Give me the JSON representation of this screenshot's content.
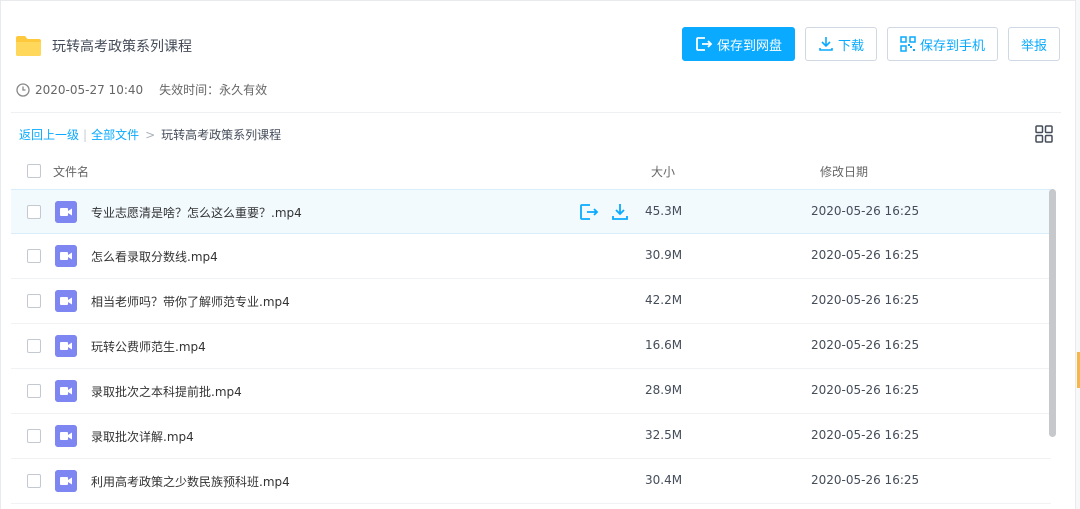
{
  "share": {
    "title": "玩转高考政策系列课程",
    "date": "2020-05-27 10:40",
    "expire_label": "失效时间：",
    "expire_value": "永久有效"
  },
  "actions": {
    "save_to_disk": "保存到网盘",
    "download": "下载",
    "save_to_phone": "保存到手机",
    "report": "举报"
  },
  "breadcrumb": {
    "back": "返回上一级",
    "sep": "|",
    "all_files": "全部文件",
    "arrow": ">",
    "current": "玩转高考政策系列课程"
  },
  "columns": {
    "name": "文件名",
    "size": "大小",
    "date": "修改日期"
  },
  "files": [
    {
      "name": "专业志愿清是啥？怎么这么重要？.mp4",
      "size": "45.3M",
      "date": "2020-05-26 16:25"
    },
    {
      "name": "怎么看录取分数线.mp4",
      "size": "30.9M",
      "date": "2020-05-26 16:25"
    },
    {
      "name": "相当老师吗？带你了解师范专业.mp4",
      "size": "42.2M",
      "date": "2020-05-26 16:25"
    },
    {
      "name": "玩转公费师范生.mp4",
      "size": "16.6M",
      "date": "2020-05-26 16:25"
    },
    {
      "name": "录取批次之本科提前批.mp4",
      "size": "28.9M",
      "date": "2020-05-26 16:25"
    },
    {
      "name": "录取批次详解.mp4",
      "size": "32.5M",
      "date": "2020-05-26 16:25"
    },
    {
      "name": "利用高考政策之少数民族预科班.mp4",
      "size": "30.4M",
      "date": "2020-05-26 16:25"
    }
  ],
  "colors": {
    "accent": "#09aaff",
    "folder": "#ffc93d",
    "video": "#7e86f2"
  },
  "icons": {
    "folder": "folder-icon",
    "clock": "clock-icon",
    "grid_view": "grid-view-icon",
    "video": "video-file-icon",
    "save": "save-icon",
    "download": "download-icon",
    "qr": "qr-code-icon"
  }
}
